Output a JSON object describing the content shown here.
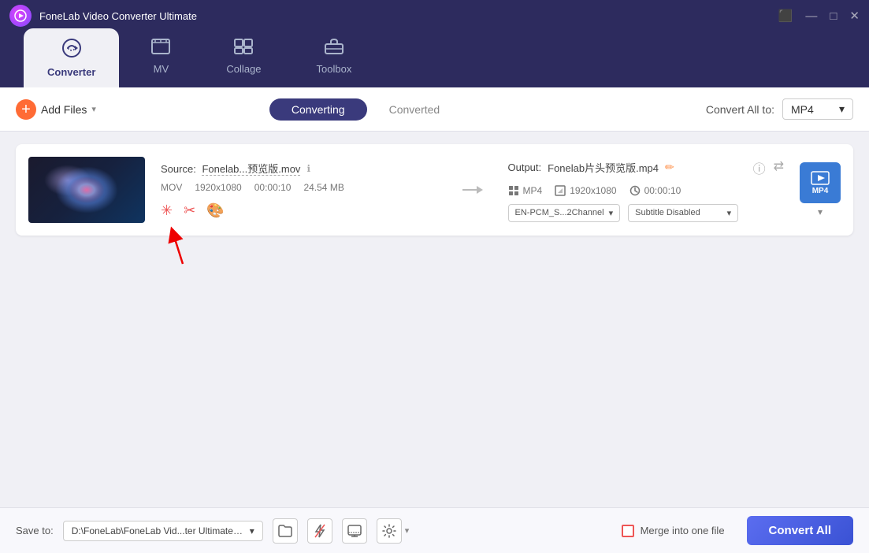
{
  "app": {
    "title": "FoneLab Video Converter Ultimate",
    "icon": "▶"
  },
  "titlebar": {
    "controls": [
      "⬛",
      "—",
      "□",
      "✕"
    ],
    "captions_icon": "⬛",
    "minimize": "—",
    "maximize": "□",
    "close": "✕"
  },
  "nav": {
    "tabs": [
      {
        "id": "converter",
        "label": "Converter",
        "icon": "🔄",
        "active": true
      },
      {
        "id": "mv",
        "label": "MV",
        "icon": "🖼"
      },
      {
        "id": "collage",
        "label": "Collage",
        "icon": "⊞"
      },
      {
        "id": "toolbox",
        "label": "Toolbox",
        "icon": "🧰"
      }
    ]
  },
  "toolbar": {
    "add_files_label": "Add Files",
    "converting_tab": "Converting",
    "converted_tab": "Converted",
    "convert_all_to_label": "Convert All to:",
    "format_value": "MP4",
    "chevron": "▾"
  },
  "file_item": {
    "source_label": "Source:",
    "source_filename": "Fonelab...预览版.mov",
    "format": "MOV",
    "resolution": "1920x1080",
    "duration": "00:00:10",
    "filesize": "24.54 MB",
    "output_label": "Output:",
    "output_filename": "Fonelab片头预览版.mp4",
    "out_format": "MP4",
    "out_resolution": "1920x1080",
    "out_duration": "00:00:10",
    "audio_track": "EN-PCM_S...2Channel",
    "subtitle": "Subtitle Disabled"
  },
  "bottom": {
    "save_to_label": "Save to:",
    "save_path": "D:\\FoneLab\\FoneLab Vid...ter Ultimate\\Converted",
    "merge_label": "Merge into one file",
    "convert_all_label": "Convert All"
  },
  "icons": {
    "info": "ℹ",
    "edit": "✏",
    "info2": "ⓘ",
    "swap": "⇄",
    "film": "▦",
    "fullscreen": "⛶",
    "clock": "⏱",
    "chevron_down": "▾",
    "folder": "📁",
    "flash_off": "⚡",
    "screen": "⬚",
    "gear": "⚙",
    "more": "▾"
  }
}
